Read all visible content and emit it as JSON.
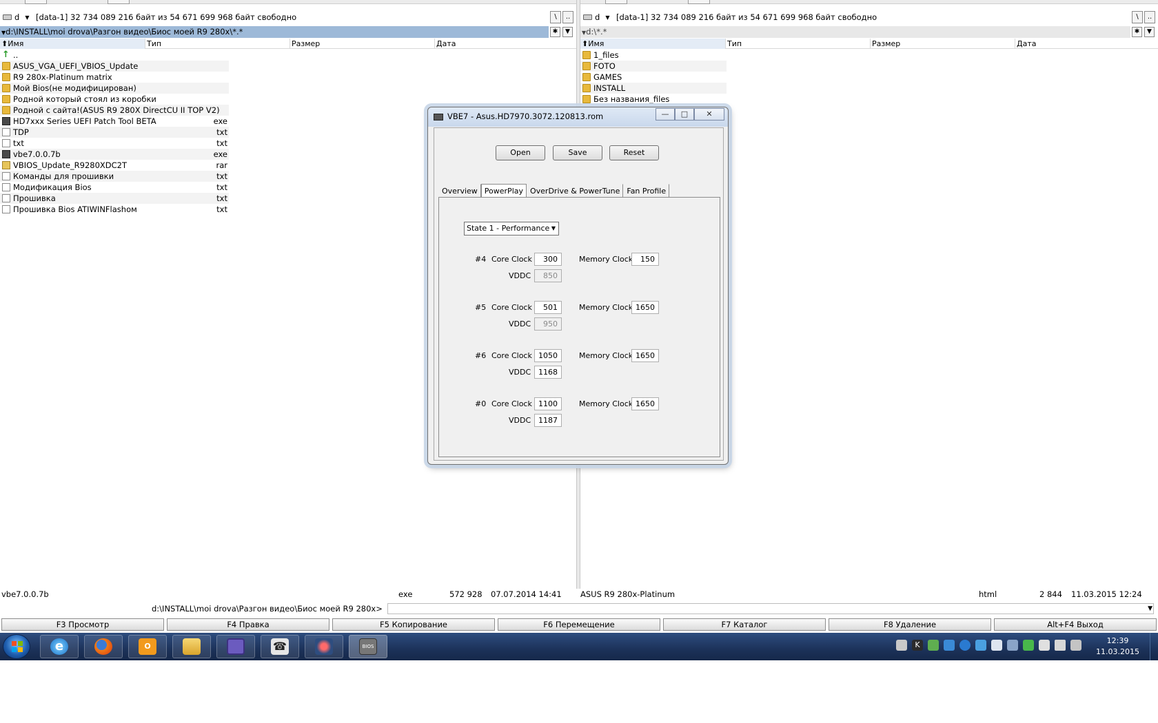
{
  "left_panel": {
    "drive": "d",
    "volume_info": "[data-1]  32 734 089 216 байт из 54 671 699 968 байт свободно",
    "path": "d:\\INSTALL\\moi drova\\Разгон видео\\Биос моей R9 280x\\*.*",
    "columns": [
      "Имя",
      "Тип",
      "Размер",
      "Дата"
    ],
    "files": [
      {
        "name": "..",
        "ext": "",
        "icon": "up-arrow-icon"
      },
      {
        "name": "ASUS_VGA_UEFI_VBIOS_Update",
        "ext": "",
        "icon": "folder-icon"
      },
      {
        "name": "R9 280x-Platinum matrix",
        "ext": "",
        "icon": "folder-icon"
      },
      {
        "name": "Мой Bios(не модифицирован)",
        "ext": "",
        "icon": "folder-icon"
      },
      {
        "name": "Родной который стоял из коробки",
        "ext": "",
        "icon": "folder-icon"
      },
      {
        "name": "Родной с сайта!(ASUS R9 280X DirectCU II TOP V2)",
        "ext": "",
        "icon": "folder-icon"
      },
      {
        "name": "HD7xxx Series UEFI Patch Tool BETA",
        "ext": "exe",
        "icon": "exe-icon"
      },
      {
        "name": "TDP",
        "ext": "txt",
        "icon": "document-icon"
      },
      {
        "name": "txt",
        "ext": "txt",
        "icon": "document-icon"
      },
      {
        "name": "vbe7.0.0.7b",
        "ext": "exe",
        "icon": "exe-icon"
      },
      {
        "name": "VBIOS_Update_R9280XDC2T",
        "ext": "rar",
        "icon": "archive-icon"
      },
      {
        "name": "Команды для прошивки",
        "ext": "txt",
        "icon": "document-icon"
      },
      {
        "name": "Модификация Bios",
        "ext": "txt",
        "icon": "document-icon"
      },
      {
        "name": "Прошивка",
        "ext": "txt",
        "icon": "document-icon"
      },
      {
        "name": "Прошивка Bios ATIWINFlashом",
        "ext": "txt",
        "icon": "document-icon"
      }
    ],
    "status": {
      "name": "vbe7.0.0.7b",
      "type": "exe",
      "size": "572 928",
      "date": "07.07.2014 14:41"
    }
  },
  "right_panel": {
    "drive": "d",
    "volume_info": "[data-1]  32 734 089 216 байт из 54 671 699 968 байт свободно",
    "path": "d:\\*.*",
    "columns": [
      "Имя",
      "Тип",
      "Размер",
      "Дата"
    ],
    "files": [
      {
        "name": "1_files",
        "icon": "folder-icon"
      },
      {
        "name": "FOTO",
        "icon": "folder-icon"
      },
      {
        "name": "GAMES",
        "icon": "folder-icon"
      },
      {
        "name": "INSTALL",
        "icon": "folder-icon"
      },
      {
        "name": "Без названия_files",
        "icon": "folder-icon"
      }
    ],
    "status": {
      "name": "ASUS R9 280x-Platinum",
      "type": "html",
      "size": "2 844",
      "date": "11.03.2015 12:24"
    }
  },
  "command_line": {
    "prompt": "d:\\INSTALL\\moi drova\\Разгон видео\\Биос моей R9 280x>",
    "value": ""
  },
  "function_keys": [
    "F3 Просмотр",
    "F4 Правка",
    "F5 Копирование",
    "F6 Перемещение",
    "F7 Каталог",
    "F8 Удаление",
    "Alt+F4 Выход"
  ],
  "dialog": {
    "title": "VBE7 - Asus.HD7970.3072.120813.rom",
    "buttons": {
      "open": "Open",
      "save": "Save",
      "reset": "Reset"
    },
    "tabs": [
      "Overview",
      "PowerPlay",
      "OverDrive & PowerTune",
      "Fan Profile"
    ],
    "active_tab": "PowerPlay",
    "state_select": "State 1 - Performance",
    "labels": {
      "core_clock": "Core Clock",
      "memory_clock": "Memory Clock",
      "vddc": "VDDC"
    },
    "states": [
      {
        "id": "#4",
        "core": "300",
        "memory": "150",
        "vddc": "850",
        "vddc_disabled": true
      },
      {
        "id": "#5",
        "core": "501",
        "memory": "1650",
        "vddc": "950",
        "vddc_disabled": true
      },
      {
        "id": "#6",
        "core": "1050",
        "memory": "1650",
        "vddc": "1168",
        "vddc_disabled": false
      },
      {
        "id": "#0",
        "core": "1100",
        "memory": "1650",
        "vddc": "1187",
        "vddc_disabled": false
      }
    ]
  },
  "taskbar": {
    "apps": [
      "internet-explorer-icon",
      "firefox-icon",
      "outlook-icon",
      "explorer-folder-icon",
      "floppy-save-icon",
      "phone-icon",
      "flower-tool-icon",
      "bios-tool-icon"
    ],
    "active_app": "bios-tool-icon",
    "bios_label": "BIOS",
    "time": "12:39",
    "date": "11.03.2015"
  },
  "colors": {
    "active_path": "#9db9d8",
    "folder": "#e8b93c",
    "taskbar": "#1c325a"
  }
}
